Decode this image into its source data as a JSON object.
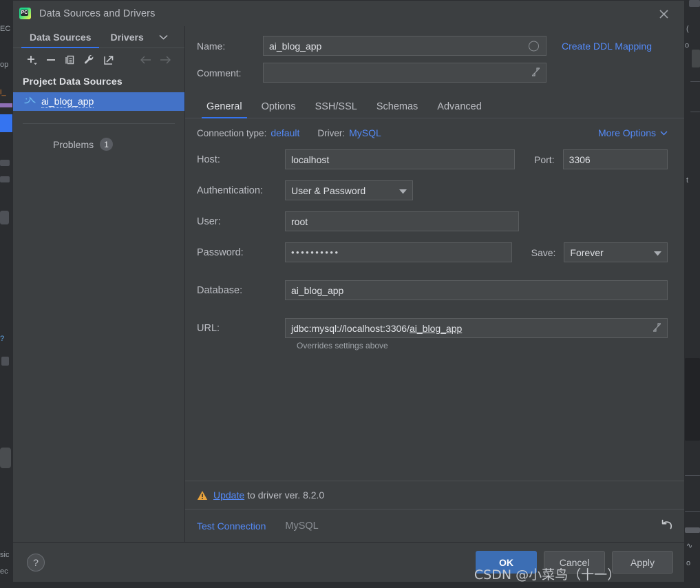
{
  "window": {
    "title": "Data Sources and Drivers",
    "app_icon": "pycharm-icon",
    "close_icon": "close-icon"
  },
  "sidebar": {
    "tabs": [
      {
        "label": "Data Sources",
        "active": true
      },
      {
        "label": "Drivers",
        "active": false
      }
    ],
    "tabs_overflow_icon": "chevron-down-icon",
    "toolbar": [
      {
        "name": "add-button",
        "icon": "plus-icon",
        "enabled": true
      },
      {
        "name": "remove-button",
        "icon": "minus-icon",
        "enabled": true
      },
      {
        "name": "duplicate-button",
        "icon": "copy-icon",
        "enabled": true
      },
      {
        "name": "properties-button",
        "icon": "wrench-icon",
        "enabled": true
      },
      {
        "name": "jump-to-source-button",
        "icon": "external-link-icon",
        "enabled": true
      },
      {
        "name": "back-button",
        "icon": "arrow-left-icon",
        "enabled": false
      },
      {
        "name": "forward-button",
        "icon": "arrow-right-icon",
        "enabled": false
      }
    ],
    "group_title": "Project Data Sources",
    "items": [
      {
        "label": "ai_blog_app",
        "icon": "mysql-dolphin-icon",
        "selected": true
      }
    ],
    "problems": {
      "label": "Problems",
      "count": "1"
    }
  },
  "main": {
    "name_label": "Name:",
    "name_value": "ai_blog_app",
    "name_color_icon": "circle-icon",
    "create_ddl_mapping": "Create DDL Mapping",
    "comment_label": "Comment:",
    "comment_value": "",
    "comment_expand_icon": "expand-icon",
    "tabs": [
      {
        "label": "General",
        "active": true
      },
      {
        "label": "Options",
        "active": false
      },
      {
        "label": "SSH/SSL",
        "active": false
      },
      {
        "label": "Schemas",
        "active": false
      },
      {
        "label": "Advanced",
        "active": false
      }
    ],
    "connection_type_label": "Connection type:",
    "connection_type_value": "default",
    "driver_label": "Driver:",
    "driver_value": "MySQL",
    "more_options": "More Options",
    "more_options_icon": "chevron-down-icon",
    "host_label": "Host:",
    "host_value": "localhost",
    "port_label": "Port:",
    "port_value": "3306",
    "auth_label": "Authentication:",
    "auth_value": "User & Password",
    "user_label": "User:",
    "user_value": "root",
    "password_label": "Password:",
    "password_value": "••••••••••",
    "save_label": "Save:",
    "save_value": "Forever",
    "database_label": "Database:",
    "database_value": "ai_blog_app",
    "url_label": "URL:",
    "url_prefix": "jdbc:mysql://localhost:3306/",
    "url_db": "ai_blog_app",
    "url_expand_icon": "expand-icon",
    "url_hint": "Overrides settings above",
    "update_warning_icon": "warning-triangle-icon",
    "update_link": "Update",
    "update_text": " to driver ver. 8.2.0",
    "test_connection": "Test Connection",
    "test_connection_status": "MySQL",
    "revert_icon": "revert-arrow-icon"
  },
  "footer": {
    "help_label": "?",
    "ok_label": "OK",
    "cancel_label": "Cancel",
    "apply_label": "Apply"
  },
  "watermark": "CSDN @小菜鸟（十一）",
  "colors": {
    "accent_blue": "#3574f0",
    "link_blue": "#548af7",
    "selection_blue": "#4372c7",
    "panel_bg": "#3c3f41",
    "input_bg": "#45484a",
    "warning_amber": "#e8a33d"
  }
}
